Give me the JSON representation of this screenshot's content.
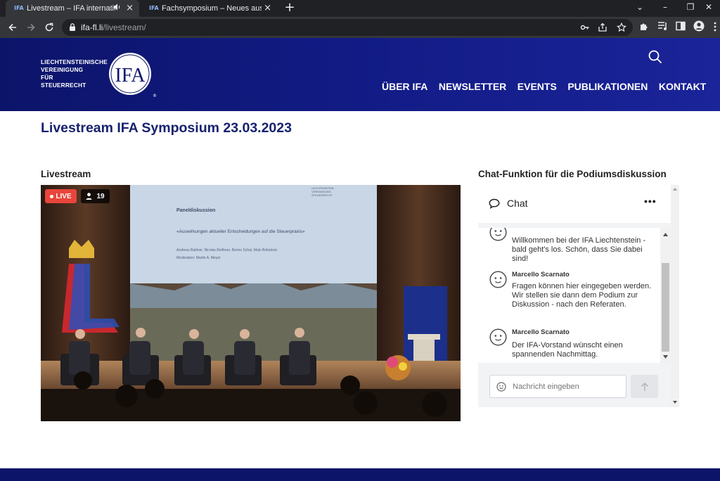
{
  "browser": {
    "tabs": [
      {
        "title": "Livestream – IFA internationa",
        "active": true
      },
      {
        "title": "Fachsymposium – Neues aus der",
        "active": false
      }
    ],
    "url_host": "ifa-fl.li",
    "url_path": "/livestream/"
  },
  "header": {
    "logo_lines": [
      "LIECHTENSTEINISCHE",
      "VEREINIGUNG",
      "FÜR",
      "STEUERRECHT"
    ],
    "logo_mark": "IFA",
    "nav": [
      "ÜBER IFA",
      "NEWSLETTER",
      "EVENTS",
      "PUBLIKATIONEN",
      "KONTAKT"
    ]
  },
  "page": {
    "title": "Livestream IFA Symposium 23.03.2023",
    "livestream_heading": "Livestream",
    "chat_heading": "Chat-Funktion für die Podiumsdiskussion"
  },
  "video": {
    "live_label": "LIVE",
    "viewer_count": "19",
    "slide": {
      "heading": "Paneldiskussion",
      "subtitle": "«Auswirkungen aktueller Entscheidungen auf die Steuerpraxis»",
      "speakers": "Andreas Batliner, Nicolas Reithner, Benno Schai, Malo Bobalovic",
      "moderation": "Moderation: Martin A. Meyer"
    }
  },
  "chat": {
    "title": "Chat",
    "messages": [
      {
        "author": "",
        "text": "Willkommen bei der IFA Liechtenstein - bald geht's los. Schön, dass Sie dabei sind!"
      },
      {
        "author": "Marcello Scarnato",
        "text": "Fragen können hier eingegeben werden. Wir stellen sie dann dem Podium zur Diskussion - nach den Referaten."
      },
      {
        "author": "Marcello Scarnato",
        "text": "Der IFA-Vorstand wünscht einen spannenden Nachmittag."
      }
    ],
    "input_placeholder": "Nachricht eingeben"
  },
  "colors": {
    "brand_navy": "#0c146a",
    "title_blue": "#17226e",
    "live_red": "#e8453c"
  }
}
